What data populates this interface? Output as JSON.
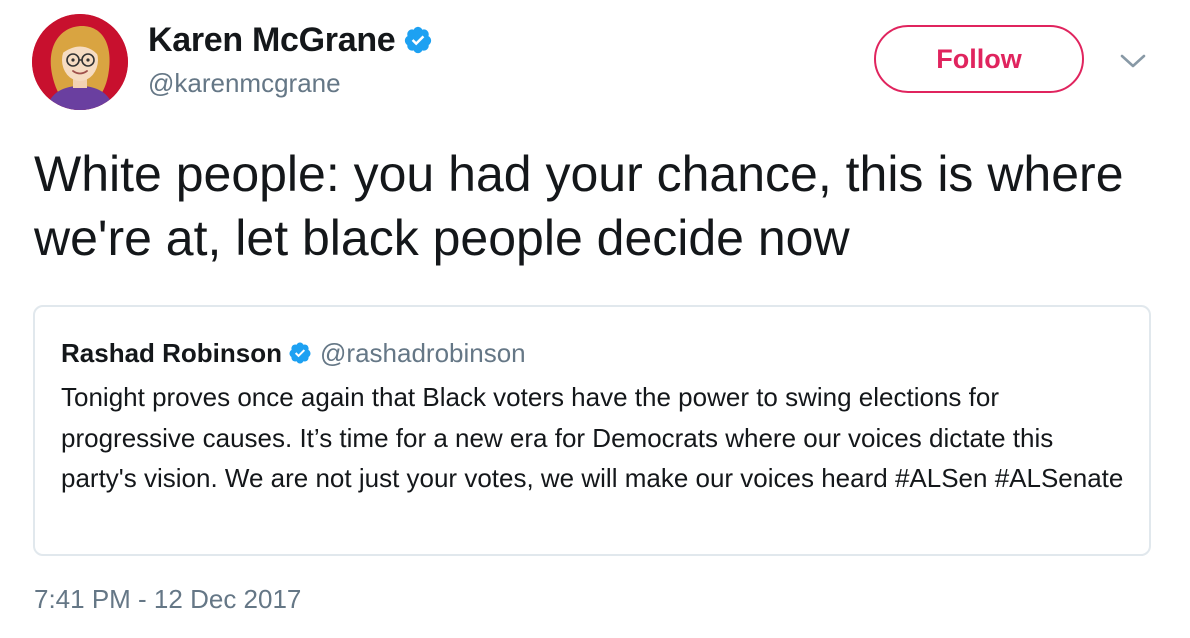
{
  "author": {
    "display_name": "Karen McGrane",
    "handle": "@karenmcgrane",
    "verified": true,
    "avatar_icon": "cartoon-portrait-avatar"
  },
  "actions": {
    "follow_label": "Follow",
    "more_icon": "chevron-down-icon"
  },
  "tweet": {
    "text": "White people: you had your chance, this is where we're at, let black people decide now",
    "timestamp": "7:41 PM - 12 Dec 2017"
  },
  "quoted_tweet": {
    "display_name": "Rashad Robinson",
    "handle": "@rashadrobinson",
    "verified": true,
    "text": "Tonight proves once again that Black voters have the power to swing elections for progressive causes. It’s time for a new era for Democrats where our voices dictate this party's vision. We are not just your votes, we will make our voices heard #ALSen #ALSenate"
  },
  "colors": {
    "follow_accent": "#e0245e",
    "verified_blue": "#1da1f2",
    "secondary_text": "#657786",
    "card_border": "#e1e8ed"
  }
}
